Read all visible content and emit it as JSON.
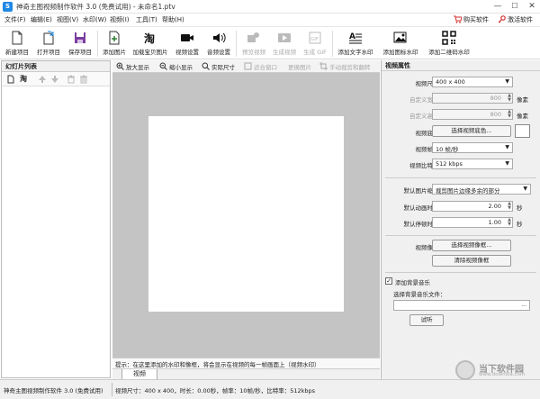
{
  "window": {
    "title": "神奇主图视频制作软件 3.0 (免费试用) - 未命名1.ptv",
    "min": "—",
    "max": "☐",
    "close": "✕"
  },
  "menu": {
    "items": [
      "文件(F)",
      "编辑(E)",
      "视图(V)",
      "水印(W)",
      "视频(I)",
      "工具(T)",
      "帮助(H)"
    ],
    "buy": "购买软件",
    "activate": "激活软件"
  },
  "toolbar": {
    "items": [
      {
        "label": "新建项目",
        "icon": "new-file-icon"
      },
      {
        "label": "打开项目",
        "icon": "open-file-icon"
      },
      {
        "label": "保存项目",
        "icon": "save-icon"
      },
      {
        "label": "添加图片",
        "icon": "add-image-icon"
      },
      {
        "label": "加载宝贝图片",
        "icon": "taobao-icon"
      },
      {
        "label": "视频设置",
        "icon": "camera-icon"
      },
      {
        "label": "音频设置",
        "icon": "audio-icon"
      },
      {
        "label": "预览视频",
        "icon": "preview-video-icon"
      },
      {
        "label": "生成视频",
        "icon": "generate-video-icon"
      },
      {
        "label": "生成 GIF",
        "icon": "gif-icon"
      },
      {
        "label": "添加文字水印",
        "icon": "text-watermark-icon"
      },
      {
        "label": "添加图标水印",
        "icon": "image-watermark-icon"
      },
      {
        "label": "添加二维码水印",
        "icon": "qrcode-icon"
      }
    ]
  },
  "left_panel": {
    "title": "幻灯片列表"
  },
  "center": {
    "tools": [
      "放大显示",
      "缩小显示",
      "实际尺寸",
      "适合窗口",
      "更换图片",
      "手动裁剪和翻转"
    ],
    "hint": "提示：在这里添加的水印和像框，将会显示在视频的每一帧画面上（视频水印）",
    "tab": "视频"
  },
  "right_panel": {
    "title": "视频属性",
    "size_label": "视频尺寸：",
    "size_value": "400 x 400",
    "custom_width_label": "自定义宽度：",
    "custom_width_value": "800",
    "custom_height_label": "自定义高度：",
    "custom_height_value": "800",
    "px_unit": "像素",
    "bg_label": "视频底色：",
    "bg_button": "选择视频底色...",
    "fps_label": "视频帧率：",
    "fps_value": "10 帧/秒",
    "bitrate_label": "视频比特率：",
    "bitrate_value": "512 kbps",
    "scale_label": "默认图片缩放：",
    "scale_value": "裁剪图片边缘多余的部分",
    "anim_label": "默认动画时长：",
    "anim_value": "2.00",
    "pause_label": "默认停顿时长：",
    "pause_value": "1.00",
    "sec_unit": "秒",
    "frame_label": "视频像框：",
    "frame_button": "选择视频像框...",
    "clear_frame_button": "清除视频像框",
    "music_checkbox": "添加背景音乐",
    "music_file_label": "选择背景音乐文件：",
    "browse": "...",
    "listen_button": "试听"
  },
  "status": {
    "app": "神奇主图视频制作软件 3.0 (免费试用)",
    "info": "视频尺寸：400 x 400，时长：0.00秒，帧率：10帧/秒，比特率：512kbps"
  },
  "watermark": {
    "name": "当下软件园",
    "url": "www.downxia.com"
  },
  "colors": {
    "accent": "#1e88e5",
    "canvas_bg": "#c4c4c4"
  }
}
